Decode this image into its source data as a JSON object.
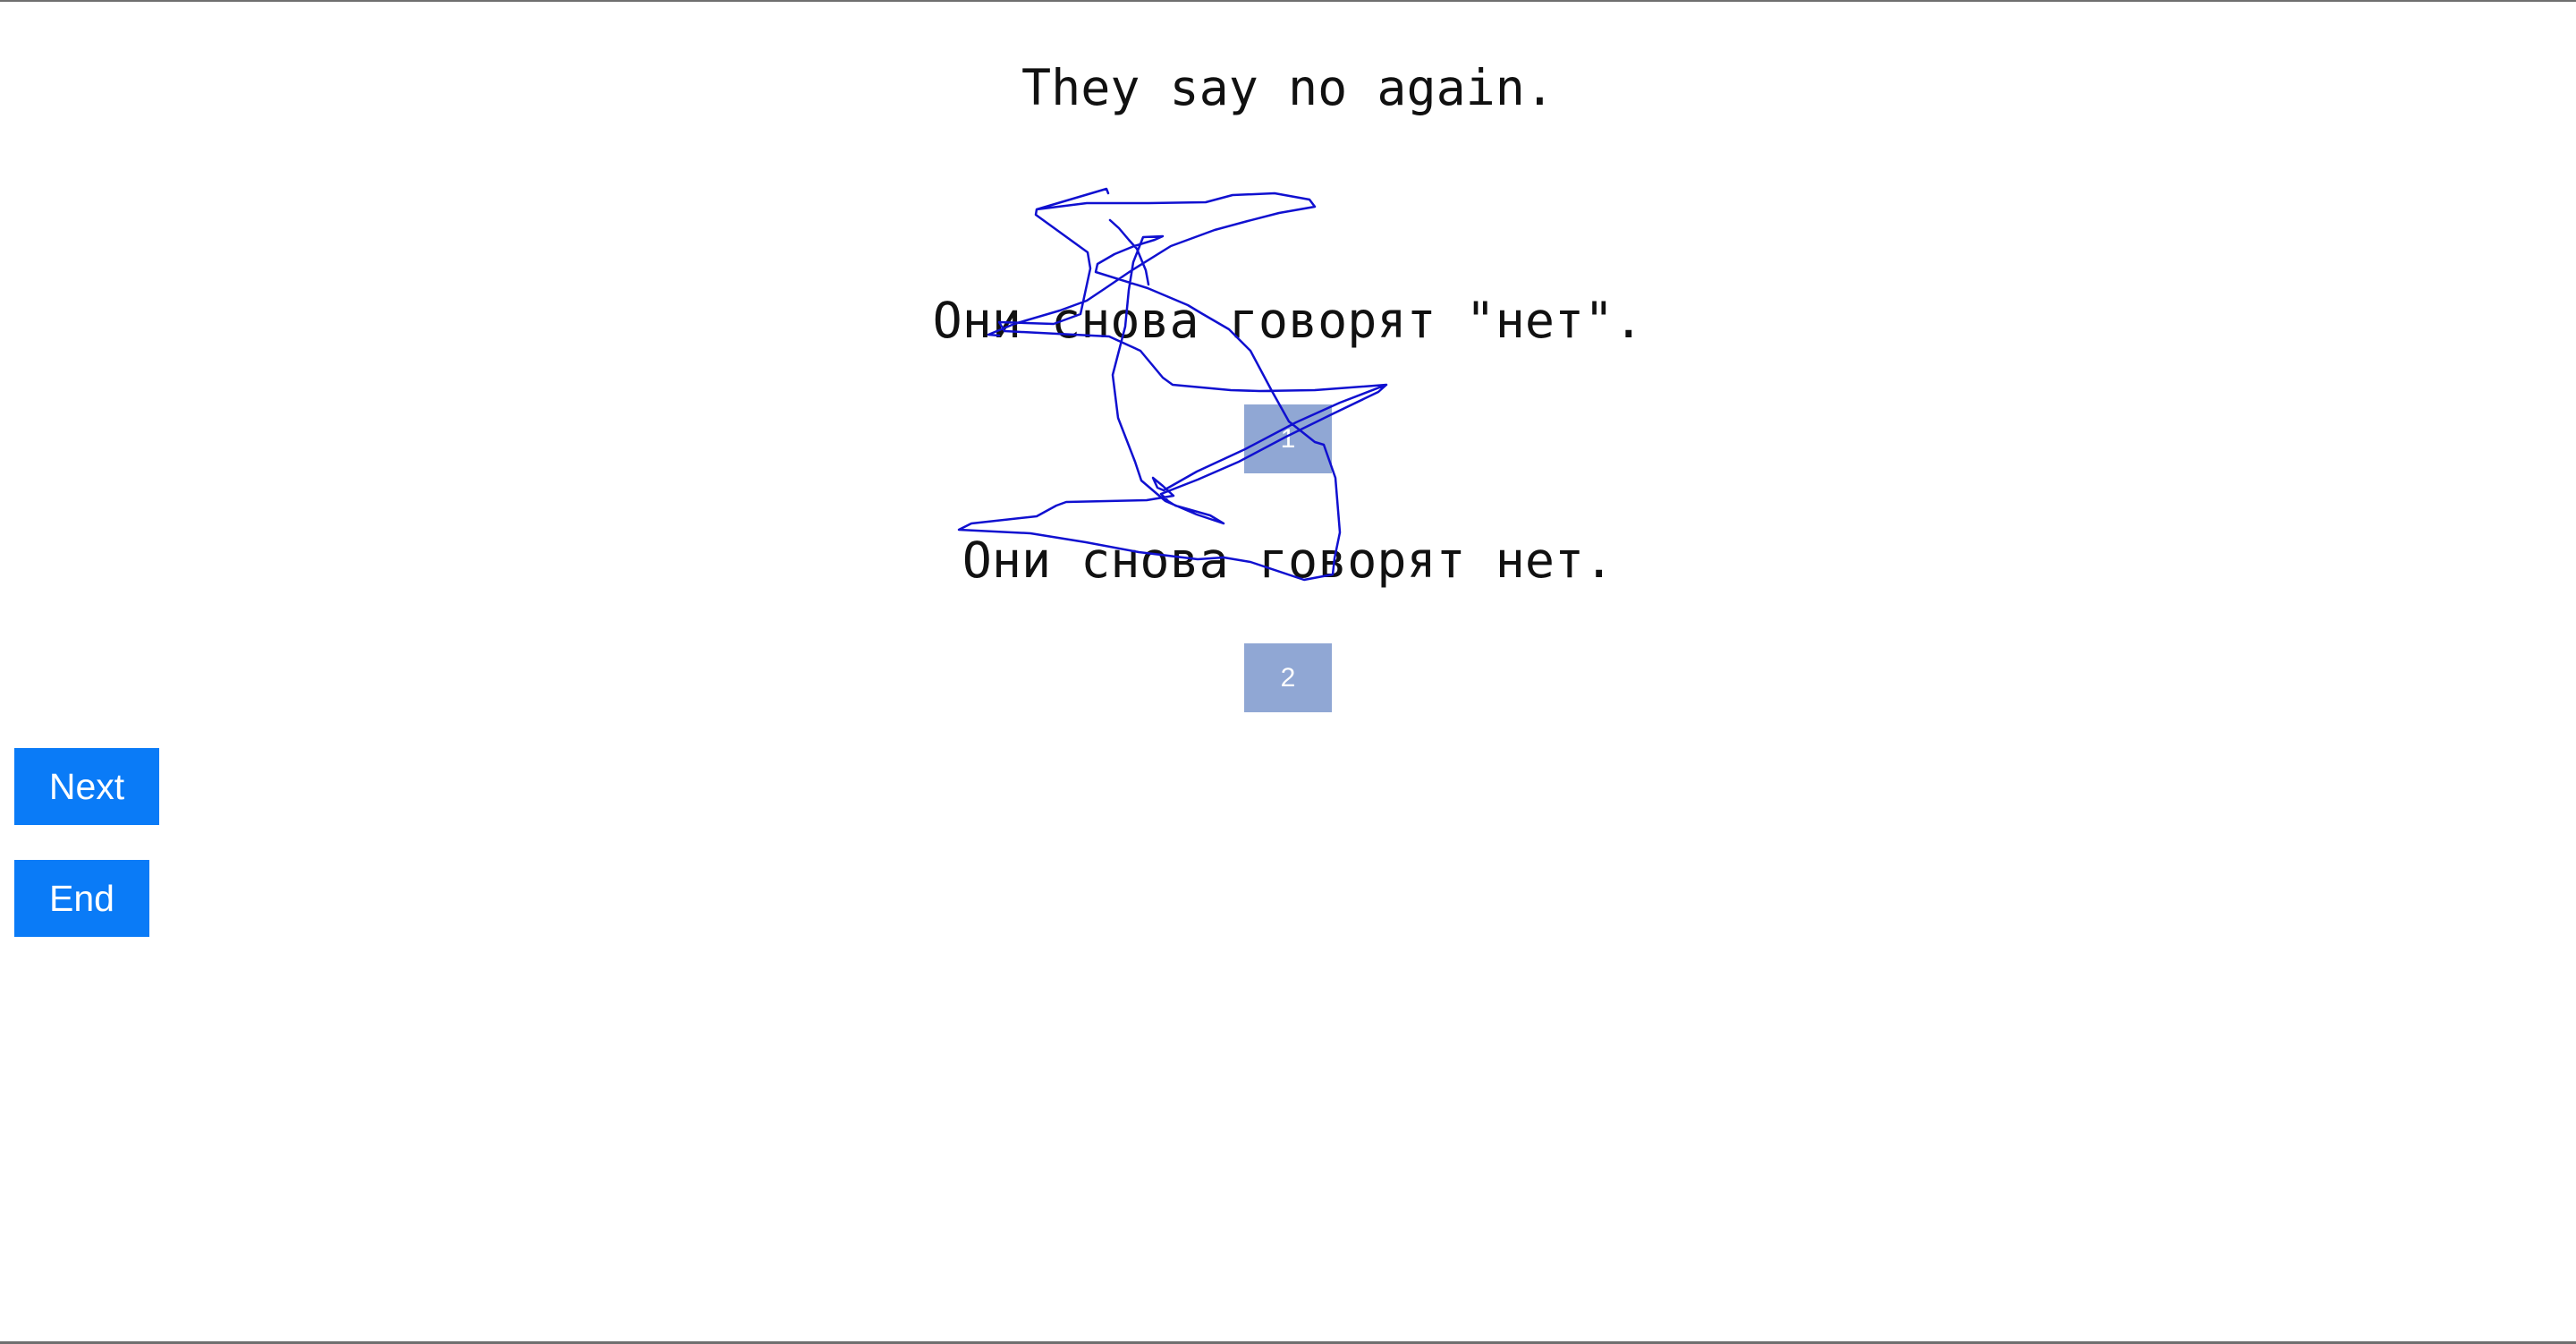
{
  "prompt": {
    "source_text": "They say no again."
  },
  "candidates": [
    {
      "text": "Они снова говорят \"нет\".",
      "rank_label": "1"
    },
    {
      "text": "Они снова говорят нет.",
      "rank_label": "2"
    }
  ],
  "buttons": {
    "next_label": "Next",
    "end_label": "End"
  },
  "colors": {
    "button_bg": "#0a7bf7",
    "rank_box_bg": "#90a7d4",
    "scribble_stroke": "#1010d0"
  }
}
